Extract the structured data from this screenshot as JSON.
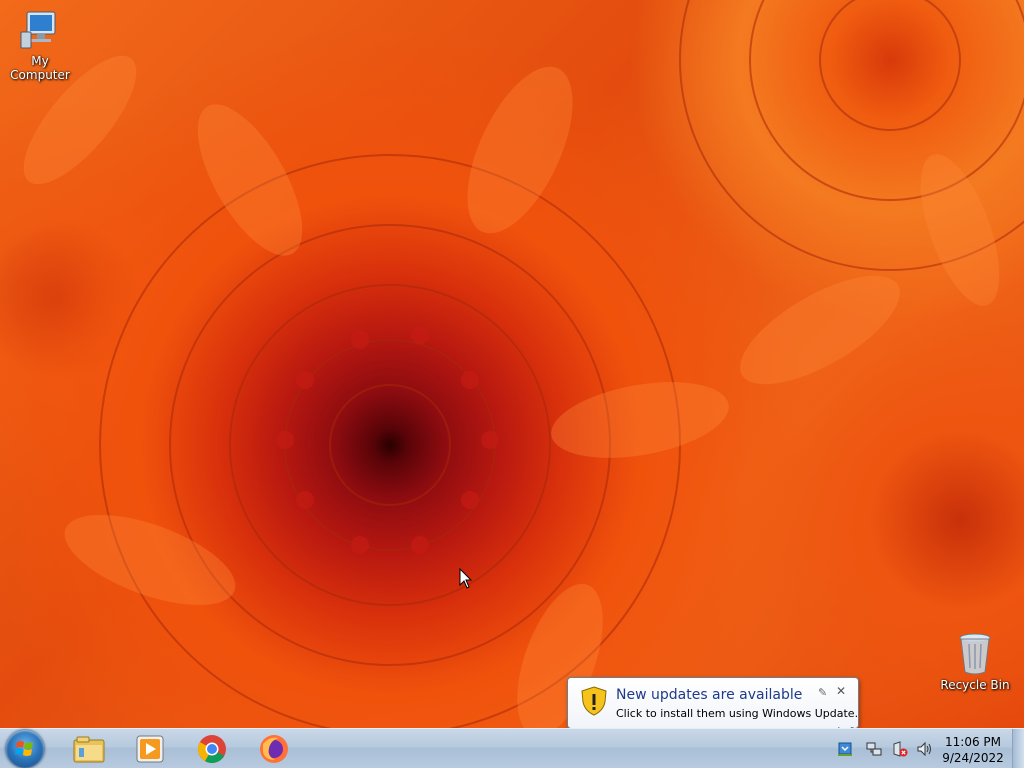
{
  "desktop": {
    "icons": [
      {
        "label": "My Computer",
        "icon": "computer-icon"
      },
      {
        "label": "Recycle Bin",
        "icon": "recycle-bin-icon"
      }
    ]
  },
  "notification": {
    "title": "New updates are available",
    "text": "Click to install them using Windows Update.",
    "icon": "warning-shield-icon",
    "pin_glyph": "✎",
    "close_glyph": "✕"
  },
  "taskbar": {
    "pinned": [
      {
        "name": "file-explorer",
        "icon": "folder-icon"
      },
      {
        "name": "media-player",
        "icon": "media-player-icon"
      },
      {
        "name": "chrome",
        "icon": "chrome-icon"
      },
      {
        "name": "firefox",
        "icon": "firefox-icon"
      }
    ],
    "tray": [
      "windows-update-icon",
      "network-icon",
      "action-center-icon",
      "volume-icon"
    ],
    "clock": {
      "time": "11:06 PM",
      "date": "9/24/2022"
    }
  },
  "colors": {
    "wallpaper_main": "#e34c0e",
    "wallpaper_center": "#8e0c10",
    "taskbar": "#b6c9de",
    "balloon_title": "#1e3a8a"
  }
}
